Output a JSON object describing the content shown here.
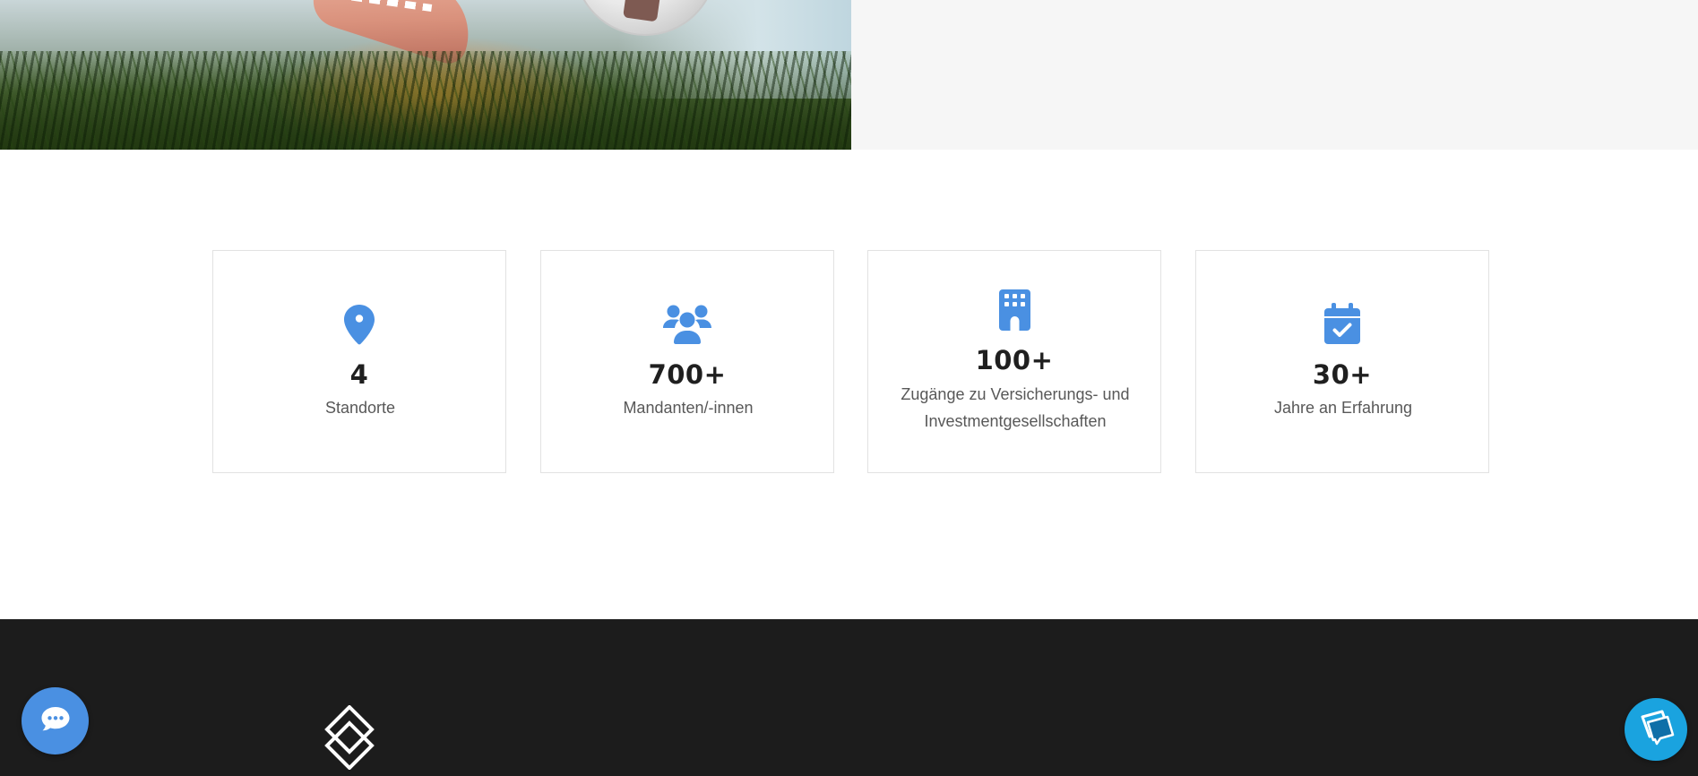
{
  "colors": {
    "accent": "#4a90e2",
    "text_dark": "#1f1f1f",
    "text_muted": "#585858",
    "card_border": "#e2e2e2",
    "panel_bg": "#f6f6f6",
    "footer_bg": "#1c1c1c",
    "support_button": "#1aa3df"
  },
  "stats": [
    {
      "icon": "map-marker-icon",
      "value": "4",
      "label": "Standorte"
    },
    {
      "icon": "users-icon",
      "value": "700+",
      "label": "Mandanten/-innen"
    },
    {
      "icon": "building-icon",
      "value": "100+",
      "label": "Zugänge zu Versicherungs- und Investmentgesellschaften"
    },
    {
      "icon": "calendar-check-icon",
      "value": "30+",
      "label": "Jahre an Erfahrung"
    }
  ],
  "floating_buttons": {
    "chat": {
      "icon": "chat-bubble-icon"
    },
    "support": {
      "icon": "chat-widget-icon"
    }
  },
  "footer": {
    "logo_icon": "diamond-logo-icon"
  }
}
